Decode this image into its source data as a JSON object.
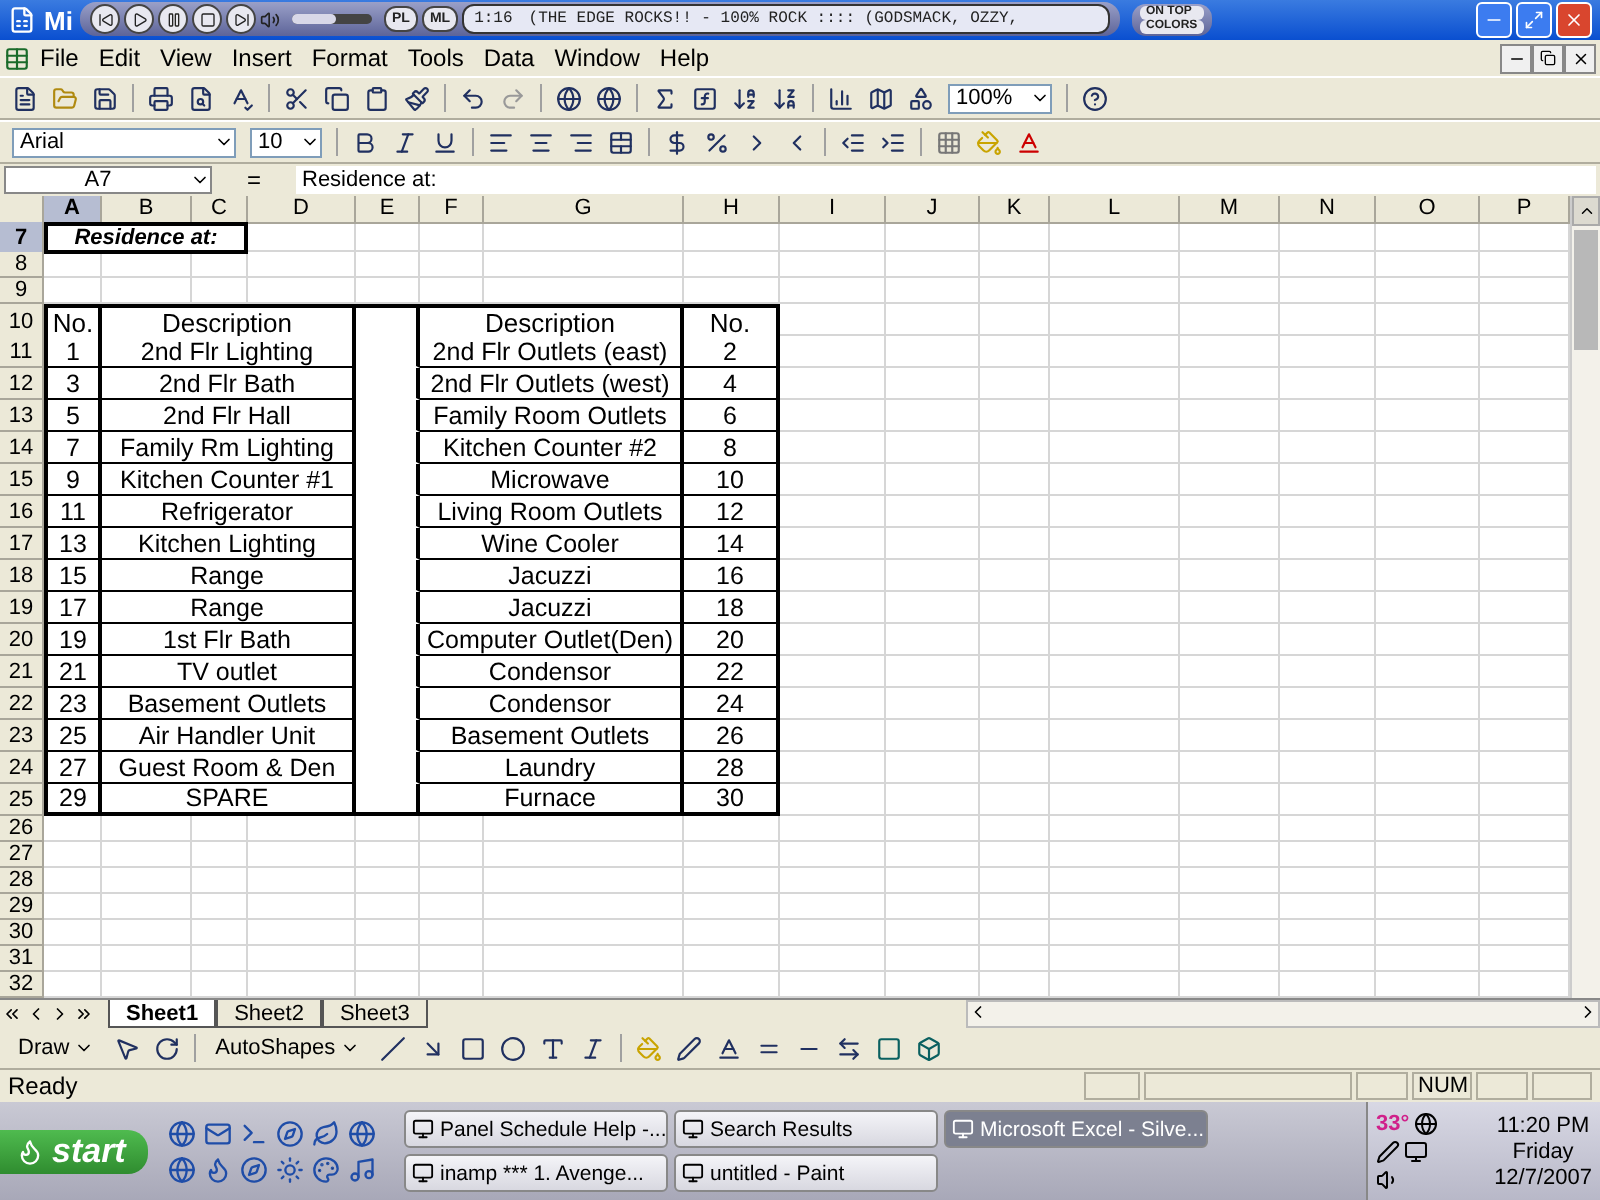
{
  "title_bar": {
    "title": "Mi"
  },
  "winamp": {
    "time": "1:16",
    "track": "(THE EDGE ROCKS!! - 100% ROCK :::: (GODSMACK, OZZY,",
    "buttons": [
      "PL",
      "ML"
    ],
    "badges": [
      "ON TOP",
      "COLORS"
    ],
    "volume": {
      "level": 0.55
    }
  },
  "menu": [
    "File",
    "Edit",
    "View",
    "Insert",
    "Format",
    "Tools",
    "Data",
    "Window",
    "Help"
  ],
  "standard_toolbar": {
    "zoom": "100%"
  },
  "formatting_toolbar": {
    "font": "Arial",
    "size": "10"
  },
  "formula_bar": {
    "name_box": "A7",
    "equals": "=",
    "formula": "Residence at:"
  },
  "columns": [
    {
      "label": "A",
      "selected": true
    },
    {
      "label": "B",
      "selected": false
    },
    {
      "label": "C",
      "selected": false
    },
    {
      "label": "D",
      "selected": false
    },
    {
      "label": "E",
      "selected": false
    },
    {
      "label": "F",
      "selected": false
    },
    {
      "label": "G",
      "selected": false
    },
    {
      "label": "H",
      "selected": false
    },
    {
      "label": "I",
      "selected": false
    },
    {
      "label": "J",
      "selected": false
    },
    {
      "label": "K",
      "selected": false
    },
    {
      "label": "L",
      "selected": false
    },
    {
      "label": "M",
      "selected": false
    },
    {
      "label": "N",
      "selected": false
    },
    {
      "label": "O",
      "selected": false
    },
    {
      "label": "P",
      "selected": false
    }
  ],
  "rows": [
    {
      "label": "7",
      "kind": "title",
      "selected": true,
      "text": "Residence at:"
    },
    {
      "label": "8",
      "kind": "blank",
      "selected": false
    },
    {
      "label": "9",
      "kind": "blank",
      "selected": false
    },
    {
      "label": "10",
      "kind": "header",
      "selected": false,
      "left_no": "No.",
      "left_description": "Description",
      "right_description": "Description",
      "right_no": "No."
    },
    {
      "label": "11",
      "kind": "circuit",
      "selected": false,
      "left_no": "1",
      "left_description": "2nd Flr Lighting",
      "right_description": "2nd Flr Outlets (east)",
      "right_no": "2"
    },
    {
      "label": "12",
      "kind": "circuit",
      "selected": false,
      "left_no": "3",
      "left_description": "2nd Flr Bath",
      "right_description": "2nd Flr Outlets (west)",
      "right_no": "4"
    },
    {
      "label": "13",
      "kind": "circuit",
      "selected": false,
      "left_no": "5",
      "left_description": "2nd Flr Hall",
      "right_description": "Family Room Outlets",
      "right_no": "6"
    },
    {
      "label": "14",
      "kind": "circuit",
      "selected": false,
      "left_no": "7",
      "left_description": "Family Rm Lighting",
      "right_description": "Kitchen Counter #2",
      "right_no": "8"
    },
    {
      "label": "15",
      "kind": "circuit",
      "selected": false,
      "left_no": "9",
      "left_description": "Kitchen Counter #1",
      "right_description": "Microwave",
      "right_no": "10"
    },
    {
      "label": "16",
      "kind": "circuit",
      "selected": false,
      "left_no": "11",
      "left_description": "Refrigerator",
      "right_description": "Living Room Outlets",
      "right_no": "12"
    },
    {
      "label": "17",
      "kind": "circuit",
      "selected": false,
      "left_no": "13",
      "left_description": "Kitchen Lighting",
      "right_description": "Wine Cooler",
      "right_no": "14"
    },
    {
      "label": "18",
      "kind": "circuit",
      "selected": false,
      "left_no": "15",
      "left_description": "Range",
      "right_description": "Jacuzzi",
      "right_no": "16"
    },
    {
      "label": "19",
      "kind": "circuit",
      "selected": false,
      "left_no": "17",
      "left_description": "Range",
      "right_description": "Jacuzzi",
      "right_no": "18"
    },
    {
      "label": "20",
      "kind": "circuit",
      "selected": false,
      "left_no": "19",
      "left_description": "1st Flr Bath",
      "right_description": "Computer Outlet(Den)",
      "right_no": "20"
    },
    {
      "label": "21",
      "kind": "circuit",
      "selected": false,
      "left_no": "21",
      "left_description": "TV outlet",
      "right_description": "Condensor",
      "right_no": "22"
    },
    {
      "label": "22",
      "kind": "circuit",
      "selected": false,
      "left_no": "23",
      "left_description": "Basement Outlets",
      "right_description": "Condensor",
      "right_no": "24"
    },
    {
      "label": "23",
      "kind": "circuit",
      "selected": false,
      "left_no": "25",
      "left_description": "Air Handler Unit",
      "right_description": "Basement Outlets",
      "right_no": "26"
    },
    {
      "label": "24",
      "kind": "circuit",
      "selected": false,
      "left_no": "27",
      "left_description": "Guest Room & Den",
      "right_description": "Laundry",
      "right_no": "28"
    },
    {
      "label": "25",
      "kind": "circuit",
      "selected": false,
      "left_no": "29",
      "left_description": "SPARE",
      "right_description": "Furnace",
      "right_no": "30"
    },
    {
      "label": "26",
      "kind": "blank",
      "selected": false
    },
    {
      "label": "27",
      "kind": "blank",
      "selected": false
    },
    {
      "label": "28",
      "kind": "blank",
      "selected": false
    },
    {
      "label": "29",
      "kind": "blank",
      "selected": false
    },
    {
      "label": "30",
      "kind": "blank",
      "selected": false
    },
    {
      "label": "31",
      "kind": "blank",
      "selected": false
    },
    {
      "label": "32",
      "kind": "blank",
      "selected": false
    }
  ],
  "sheet_tabs": [
    {
      "label": "Sheet1",
      "selected": true
    },
    {
      "label": "Sheet2",
      "selected": false
    },
    {
      "label": "Sheet3",
      "selected": false
    }
  ],
  "drawing_toolbar": {
    "draw": "Draw",
    "autoshapes": "AutoShapes"
  },
  "status_bar": {
    "status": "Ready",
    "num": "NUM"
  },
  "taskbar": {
    "start": "start",
    "windows": [
      {
        "label": "Panel Schedule Help -...",
        "selected": false
      },
      {
        "label": "Search Results",
        "selected": false
      },
      {
        "label": "Microsoft Excel - Silve...",
        "selected": true
      },
      {
        "label": "inamp *** 1. Avenge...",
        "selected": false
      },
      {
        "label": "untitled - Paint",
        "selected": false
      }
    ],
    "tray": {
      "temperature": "33°",
      "time": "11:20 PM",
      "day": "Friday",
      "date": "12/7/2007"
    }
  }
}
